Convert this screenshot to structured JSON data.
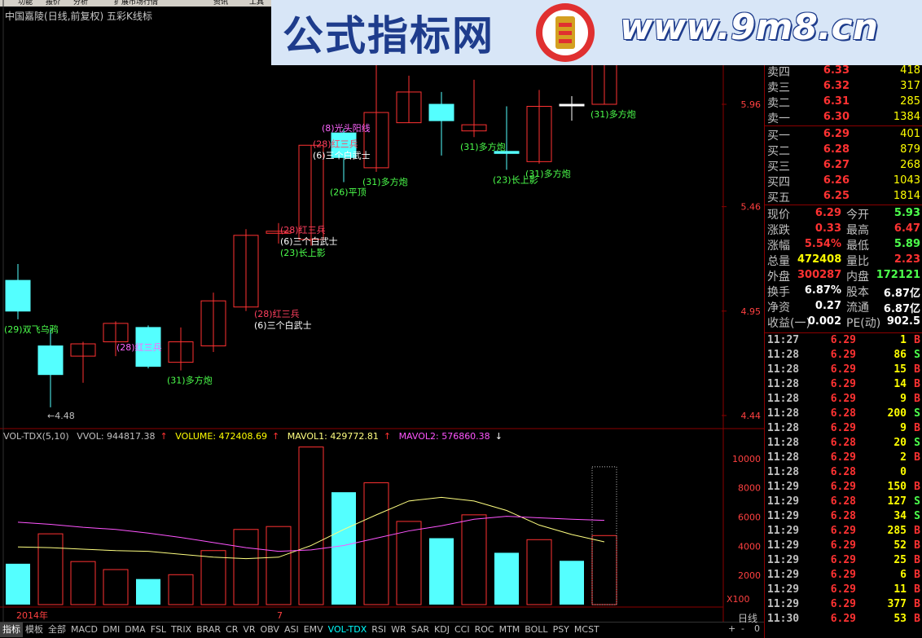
{
  "menubar": {
    "items": [
      "功能",
      "报价",
      "分析",
      "扩展市场行情",
      "资讯",
      "工具"
    ]
  },
  "chart_header": {
    "stock": "中国嘉陵",
    "mode": "(日线,前复权)",
    "indicator": "五彩K线标"
  },
  "watermark": {
    "title": "公式指标网",
    "url": "www.9m8.cn",
    "logo_small": "www.9m8.cn"
  },
  "colors": {
    "up": "#ff3232",
    "down": "#54ffff",
    "flat": "#ffffff",
    "vol_text": "#ffff00",
    "label_green": "#4cff4c",
    "label_purple": "#ff66ff",
    "label_red": "#ff4060",
    "ma1": "#ffff80",
    "ma2": "#ff55ff",
    "frame": "#8b0000"
  },
  "chart_data": [
    {
      "type": "candlestick",
      "title": "中国嘉陵(日线,前复权) 五彩K线标",
      "y_ticks": [
        "5.96",
        "5.46",
        "4.95",
        "4.44"
      ],
      "ylim": [
        4.4,
        6.35
      ],
      "x_labels": [
        "2014年",
        "7"
      ],
      "min_marker": "←4.48",
      "candles": [
        {
          "o": 5.1,
          "h": 5.18,
          "l": 4.91,
          "c": 4.95
        },
        {
          "o": 4.78,
          "h": 4.86,
          "l": 4.48,
          "c": 4.64
        },
        {
          "o": 4.73,
          "h": 4.8,
          "l": 4.6,
          "c": 4.79
        },
        {
          "o": 4.8,
          "h": 4.9,
          "l": 4.73,
          "c": 4.89
        },
        {
          "o": 4.87,
          "h": 4.88,
          "l": 4.67,
          "c": 4.68
        },
        {
          "o": 4.7,
          "h": 4.87,
          "l": 4.66,
          "c": 4.8
        },
        {
          "o": 4.78,
          "h": 5.04,
          "l": 4.75,
          "c": 5.0
        },
        {
          "o": 4.97,
          "h": 5.35,
          "l": 4.95,
          "c": 5.32
        },
        {
          "o": 5.33,
          "h": 5.38,
          "l": 5.28,
          "c": 5.34
        },
        {
          "o": 5.3,
          "h": 5.7,
          "l": 5.27,
          "c": 5.76
        },
        {
          "o": 5.82,
          "h": 5.84,
          "l": 5.58,
          "c": 5.7
        },
        {
          "o": 5.65,
          "h": 6.32,
          "l": 5.63,
          "c": 5.92
        },
        {
          "o": 5.87,
          "h": 6.1,
          "l": 6.5,
          "c": 6.02
        },
        {
          "o": 5.96,
          "h": 6.02,
          "l": 5.71,
          "c": 5.88
        },
        {
          "o": 5.83,
          "h": 6.08,
          "l": 5.8,
          "c": 5.86
        },
        {
          "o": 5.73,
          "h": 5.95,
          "l": 5.64,
          "c": 5.72
        },
        {
          "o": 5.68,
          "h": 6.03,
          "l": 5.67,
          "c": 5.95
        },
        {
          "o": 5.96,
          "h": 6.0,
          "l": 5.88,
          "c": 5.96
        },
        {
          "o": 5.96,
          "h": 6.47,
          "l": 5.96,
          "c": 6.29
        }
      ],
      "annotations": [
        {
          "i": 0,
          "text": "(29)双飞乌鸦",
          "color": "green",
          "pos": "below"
        },
        {
          "i": 4,
          "text": "(28)红三兵",
          "color": "purple",
          "pos": "mid"
        },
        {
          "i": 5,
          "text": "(31)多方炮",
          "color": "green",
          "pos": "below"
        },
        {
          "i": 7,
          "text": "(28)红三兵",
          "color": "red",
          "pos": "right_low"
        },
        {
          "i": 7,
          "text": "(6)三个白武士",
          "color": "white",
          "pos": "right_low2"
        },
        {
          "i": 8,
          "text": "(28)红三兵",
          "color": "red",
          "pos": "right_high"
        },
        {
          "i": 8,
          "text": "(6)三个白武士",
          "color": "white",
          "pos": "right_high2"
        },
        {
          "i": 8,
          "text": "(23)长上影",
          "color": "green",
          "pos": "right_high3"
        },
        {
          "i": 9,
          "text": "(28)红三兵",
          "color": "red",
          "pos": "right_high"
        },
        {
          "i": 9,
          "text": "(6)三个白武士",
          "color": "white",
          "pos": "right_high2"
        },
        {
          "i": 10,
          "text": "(8)光头阳线",
          "color": "purple",
          "pos": "above"
        },
        {
          "i": 10,
          "text": "(26)平顶",
          "color": "green",
          "pos": "below"
        },
        {
          "i": 11,
          "text": "(31)多方炮",
          "color": "green",
          "pos": "below"
        },
        {
          "i": 14,
          "text": "(31)多方炮",
          "color": "green",
          "pos": "below"
        },
        {
          "i": 15,
          "text": "(23)长上影",
          "color": "green",
          "pos": "below"
        },
        {
          "i": 16,
          "text": "(31)多方炮",
          "color": "green",
          "pos": "below"
        },
        {
          "i": 18,
          "text": "(31)多方炮",
          "color": "green",
          "pos": "below"
        }
      ]
    },
    {
      "type": "bar",
      "name": "VOL-TDX(5,10)",
      "legend": [
        {
          "label": "VOL-TDX(5,10)",
          "value": ""
        },
        {
          "label": "VVOL: 944817.38",
          "arrow": "↑"
        },
        {
          "label": "VOLUME: 472408.69",
          "arrow": "↑"
        },
        {
          "label": "MAVOL1: 429772.81",
          "arrow": "↑"
        },
        {
          "label": "MAVOL2: 576860.38",
          "arrow": "↓"
        }
      ],
      "y_ticks": [
        "10000",
        "8000",
        "6000",
        "4000",
        "2000"
      ],
      "y_unit": "X100",
      "ylim": [
        0,
        11000
      ],
      "values": [
        2800,
        4850,
        2950,
        2400,
        1750,
        2050,
        3700,
        5150,
        5350,
        10800,
        7700,
        8350,
        5700,
        4550,
        6150,
        3550,
        4450,
        3000,
        4730
      ],
      "dir": [
        "down",
        "up",
        "up",
        "up",
        "down",
        "up",
        "up",
        "up",
        "up",
        "up",
        "down",
        "up",
        "up",
        "down",
        "up",
        "down",
        "up",
        "down",
        "up"
      ],
      "vvol_last": 9447,
      "mavol1": [
        3950,
        3900,
        3800,
        3700,
        3650,
        3450,
        3250,
        3150,
        3250,
        4050,
        5150,
        6150,
        7100,
        7350,
        7100,
        6450,
        5450,
        4800,
        4300
      ],
      "mavol2": [
        5650,
        5500,
        5300,
        5150,
        4900,
        4600,
        4250,
        3900,
        3650,
        3750,
        4050,
        4550,
        5050,
        5400,
        5850,
        6050,
        5950,
        5850,
        5770
      ]
    }
  ],
  "quote": {
    "sells": [
      {
        "label": "卖四",
        "price": "6.33",
        "vol": "418"
      },
      {
        "label": "卖三",
        "price": "6.32",
        "vol": "317"
      },
      {
        "label": "卖二",
        "price": "6.31",
        "vol": "285"
      },
      {
        "label": "卖一",
        "price": "6.30",
        "vol": "1384"
      }
    ],
    "buys": [
      {
        "label": "买一",
        "price": "6.29",
        "vol": "401"
      },
      {
        "label": "买二",
        "price": "6.28",
        "vol": "879"
      },
      {
        "label": "买三",
        "price": "6.27",
        "vol": "268"
      },
      {
        "label": "买四",
        "price": "6.26",
        "vol": "1043"
      },
      {
        "label": "买五",
        "price": "6.25",
        "vol": "1814"
      }
    ],
    "info": [
      {
        "l1": "现价",
        "v1": "6.29",
        "c1": "#ff3232",
        "l2": "今开",
        "v2": "5.93",
        "c2": "#4cff4c"
      },
      {
        "l1": "涨跌",
        "v1": "0.33",
        "c1": "#ff3232",
        "l2": "最高",
        "v2": "6.47",
        "c2": "#ff3232"
      },
      {
        "l1": "涨幅",
        "v1": "5.54%",
        "c1": "#ff3232",
        "l2": "最低",
        "v2": "5.89",
        "c2": "#4cff4c"
      },
      {
        "l1": "总量",
        "v1": "472408",
        "c1": "#ffff00",
        "l2": "量比",
        "v2": "2.23",
        "c2": "#ff3232"
      },
      {
        "l1": "外盘",
        "v1": "300287",
        "c1": "#ff3232",
        "l2": "内盘",
        "v2": "172121",
        "c2": "#4cff4c"
      },
      {
        "l1": "换手",
        "v1": "6.87%",
        "c1": "#ffffff",
        "l2": "股本",
        "v2": "6.87亿",
        "c2": "#ffffff"
      },
      {
        "l1": "净资",
        "v1": "0.27",
        "c1": "#ffffff",
        "l2": "流通",
        "v2": "6.87亿",
        "c2": "#ffffff"
      },
      {
        "l1": "收益(一)",
        "v1": "0.002",
        "c1": "#ffffff",
        "l2": "PE(动)",
        "v2": "902.5",
        "c2": "#ffffff"
      }
    ],
    "ticks": [
      {
        "t": "11:27",
        "p": "6.29",
        "v": "1",
        "s": "B"
      },
      {
        "t": "11:28",
        "p": "6.29",
        "v": "86",
        "s": "S"
      },
      {
        "t": "11:28",
        "p": "6.29",
        "v": "15",
        "s": "B"
      },
      {
        "t": "11:28",
        "p": "6.29",
        "v": "14",
        "s": "B"
      },
      {
        "t": "11:28",
        "p": "6.29",
        "v": "9",
        "s": "B"
      },
      {
        "t": "11:28",
        "p": "6.28",
        "v": "200",
        "s": "S"
      },
      {
        "t": "11:28",
        "p": "6.29",
        "v": "9",
        "s": "B"
      },
      {
        "t": "11:28",
        "p": "6.28",
        "v": "20",
        "s": "S"
      },
      {
        "t": "11:28",
        "p": "6.29",
        "v": "2",
        "s": "B"
      },
      {
        "t": "11:28",
        "p": "6.28",
        "v": "0",
        "s": ""
      },
      {
        "t": "11:29",
        "p": "6.29",
        "v": "150",
        "s": "B"
      },
      {
        "t": "11:29",
        "p": "6.28",
        "v": "127",
        "s": "S"
      },
      {
        "t": "11:29",
        "p": "6.28",
        "v": "34",
        "s": "S"
      },
      {
        "t": "11:29",
        "p": "6.29",
        "v": "285",
        "s": "B"
      },
      {
        "t": "11:29",
        "p": "6.29",
        "v": "52",
        "s": "B"
      },
      {
        "t": "11:29",
        "p": "6.29",
        "v": "25",
        "s": "B"
      },
      {
        "t": "11:29",
        "p": "6.29",
        "v": "6",
        "s": "B"
      },
      {
        "t": "11:29",
        "p": "6.29",
        "v": "11",
        "s": "B"
      },
      {
        "t": "11:29",
        "p": "6.29",
        "v": "377",
        "s": "B"
      },
      {
        "t": "11:30",
        "p": "6.29",
        "v": "53",
        "s": "B"
      }
    ]
  },
  "tabs": [
    "指标",
    "模板",
    "全部",
    "MACD",
    "DMI",
    "DMA",
    "FSL",
    "TRIX",
    "BRAR",
    "CR",
    "VR",
    "OBV",
    "ASI",
    "EMV",
    "VOL-TDX",
    "RSI",
    "WR",
    "SAR",
    "KDJ",
    "CCI",
    "ROC",
    "MTM",
    "BOLL",
    "PSY",
    "MCST"
  ],
  "tabs_selected": "VOL-TDX",
  "period_label": "日线",
  "tab_controls": [
    "+",
    "-",
    "0"
  ]
}
